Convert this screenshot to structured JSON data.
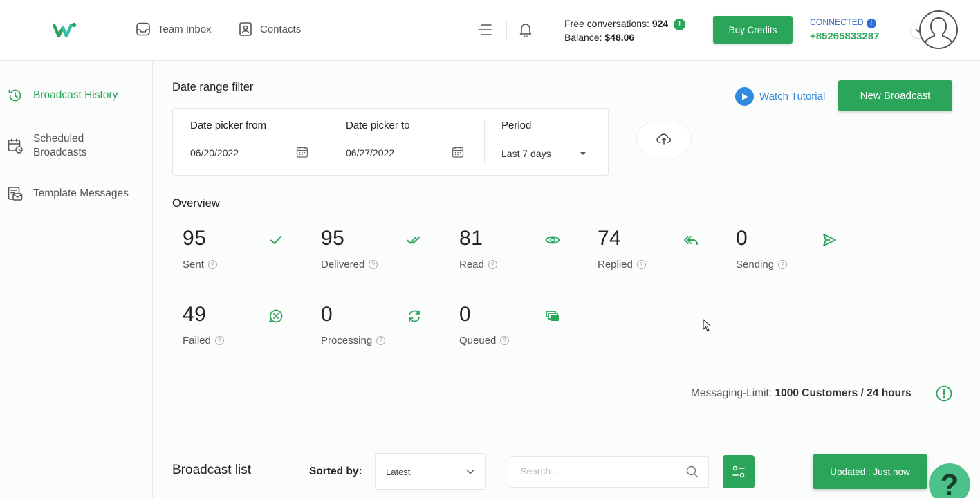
{
  "header": {
    "nav": [
      {
        "label": "Team Inbox",
        "icon": "inbox-icon"
      },
      {
        "label": "Contacts",
        "icon": "contacts-icon"
      }
    ],
    "free_conversations_label": "Free conversations:",
    "free_conversations_value": "924",
    "balance_label": "Balance:",
    "balance_value": "$48.06",
    "info_mark": "!",
    "buy_credits": "Buy Credits",
    "connection_status": "CONNECTED",
    "phone": "+85265833287"
  },
  "sidebar": {
    "items": [
      {
        "label": "Broadcast History",
        "icon": "history-icon",
        "active": true
      },
      {
        "label": "Scheduled Broadcasts",
        "icon": "calendar-clock-icon",
        "active": false
      },
      {
        "label": "Template Messages",
        "icon": "template-icon",
        "active": false
      }
    ]
  },
  "filter": {
    "title": "Date range filter",
    "from_label": "Date picker from",
    "from_value": "06/20/2022",
    "to_label": "Date picker to",
    "to_value": "06/27/2022",
    "period_label": "Period",
    "period_value": "Last 7 days"
  },
  "actions": {
    "watch_tutorial": "Watch Tutorial",
    "new_broadcast": "New Broadcast"
  },
  "overview": {
    "title": "Overview",
    "stats": [
      {
        "value": "95",
        "label": "Sent",
        "icon": "check-icon"
      },
      {
        "value": "95",
        "label": "Delivered",
        "icon": "double-check-icon"
      },
      {
        "value": "81",
        "label": "Read",
        "icon": "eye-icon"
      },
      {
        "value": "74",
        "label": "Replied",
        "icon": "reply-all-icon"
      },
      {
        "value": "0",
        "label": "Sending",
        "icon": "send-icon"
      },
      {
        "value": "49",
        "label": "Failed",
        "icon": "failed-icon"
      },
      {
        "value": "0",
        "label": "Processing",
        "icon": "refresh-icon"
      },
      {
        "value": "0",
        "label": "Queued",
        "icon": "queue-icon"
      }
    ],
    "help_mark": "?"
  },
  "messaging_limit": {
    "label": "Messaging-Limit:",
    "value": "1000 Customers / 24 hours"
  },
  "broadcast_list": {
    "title": "Broadcast list",
    "sorted_by_label": "Sorted by:",
    "sort_value": "Latest",
    "search_placeholder": "Search...",
    "updated": "Updated : Just now"
  },
  "help_button": "?",
  "colors": {
    "brand_green": "#2aa55a",
    "link_blue": "#2f8ae0",
    "help_green": "#4cc28a"
  }
}
